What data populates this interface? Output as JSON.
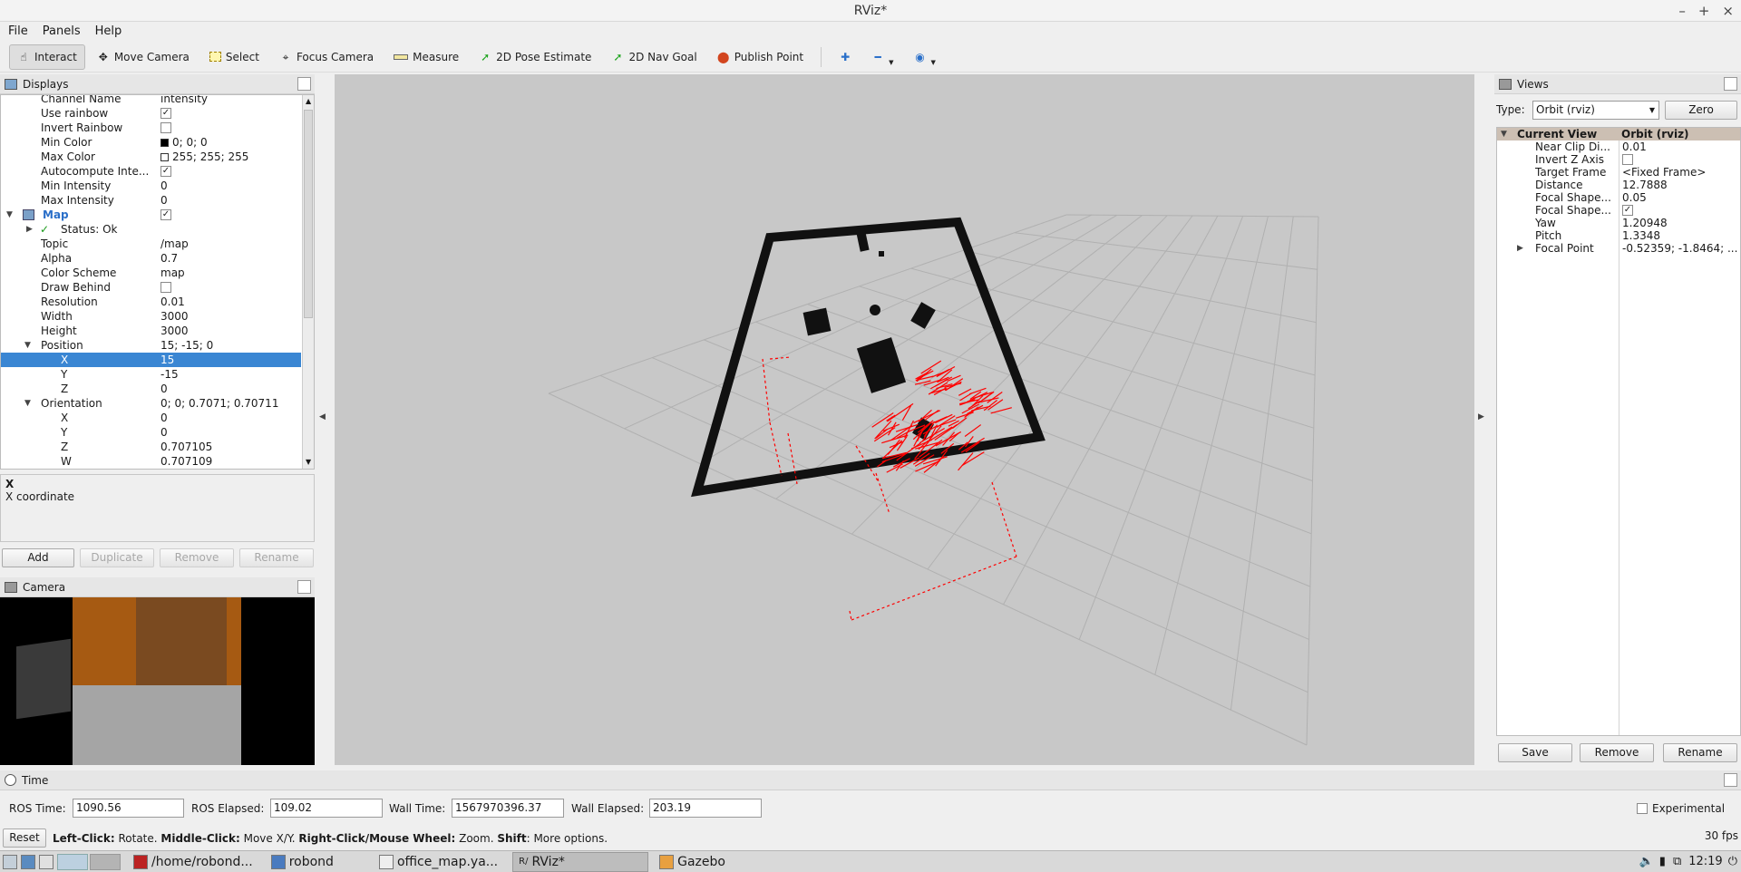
{
  "window": {
    "title": "RViz*",
    "buttons": [
      "–",
      "+",
      "×"
    ]
  },
  "menu": [
    "File",
    "Panels",
    "Help"
  ],
  "toolbar": {
    "tools": [
      "Interact",
      "Move Camera",
      "Select",
      "Focus Camera",
      "Measure",
      "2D Pose Estimate",
      "2D Nav Goal",
      "Publish Point"
    ]
  },
  "displays": {
    "title": "Displays",
    "rows": [
      {
        "key": "Channel Name",
        "value": "intensity"
      },
      {
        "key": "Use rainbow",
        "check": "✓"
      },
      {
        "key": "Invert Rainbow",
        "check": ""
      },
      {
        "key": "Min Color",
        "value": "0; 0; 0"
      },
      {
        "key": "Max Color",
        "value": "255; 255; 255"
      },
      {
        "key": "Autocompute Inte...",
        "check": "✓"
      },
      {
        "key": "Min Intensity",
        "value": "0"
      },
      {
        "key": "Max Intensity",
        "value": "0"
      },
      {
        "key": "Map",
        "check": "✓"
      },
      {
        "key": "Status: Ok"
      },
      {
        "key": "Topic",
        "value": "/map"
      },
      {
        "key": "Alpha",
        "value": "0.7"
      },
      {
        "key": "Color Scheme",
        "value": "map"
      },
      {
        "key": "Draw Behind",
        "check": ""
      },
      {
        "key": "Resolution",
        "value": "0.01"
      },
      {
        "key": "Width",
        "value": "3000"
      },
      {
        "key": "Height",
        "value": "3000"
      },
      {
        "key": "Position",
        "value": "15; -15; 0"
      },
      {
        "key": "X",
        "value": "15"
      },
      {
        "key": "Y",
        "value": "-15"
      },
      {
        "key": "Z",
        "value": "0"
      },
      {
        "key": "Orientation",
        "value": "0; 0; 0.7071; 0.70711"
      },
      {
        "key": "X",
        "value": "0"
      },
      {
        "key": "Y",
        "value": "0"
      },
      {
        "key": "Z",
        "value": "0.707105"
      },
      {
        "key": "W",
        "value": "0.707109"
      }
    ],
    "desc_title": "X",
    "desc_text": "X coordinate",
    "buttons": [
      "Add",
      "Duplicate",
      "Remove",
      "Rename"
    ]
  },
  "camera": {
    "title": "Camera"
  },
  "views": {
    "title": "Views",
    "type_label": "Type:",
    "type_value": "Orbit (rviz)",
    "zero": "Zero",
    "header_key": "Current View",
    "header_value": "Orbit (rviz)",
    "rows": [
      {
        "key": "Near Clip Di...",
        "value": "0.01"
      },
      {
        "key": "Invert Z Axis",
        "check": ""
      },
      {
        "key": "Target Frame",
        "value": "<Fixed Frame>"
      },
      {
        "key": "Distance",
        "value": "12.7888"
      },
      {
        "key": "Focal Shape...",
        "value": "0.05"
      },
      {
        "key": "Focal Shape...",
        "check": "✓"
      },
      {
        "key": "Yaw",
        "value": "1.20948"
      },
      {
        "key": "Pitch",
        "value": "1.3348"
      },
      {
        "key": "Focal Point",
        "value": "-0.52359; -1.8464; ..."
      }
    ],
    "buttons": [
      "Save",
      "Remove",
      "Rename"
    ]
  },
  "time": {
    "title": "Time",
    "ros_time_label": "ROS Time:",
    "ros_time": "1090.56",
    "ros_elapsed_label": "ROS Elapsed:",
    "ros_elapsed": "109.02",
    "wall_time_label": "Wall Time:",
    "wall_time": "1567970396.37",
    "wall_elapsed_label": "Wall Elapsed:",
    "wall_elapsed": "203.19",
    "experimental": "Experimental"
  },
  "status": {
    "reset": "Reset",
    "b1": "Left-Click:",
    "t1": " Rotate. ",
    "b2": "Middle-Click:",
    "t2": " Move X/Y. ",
    "b3": "Right-Click/Mouse Wheel:",
    "t3": " Zoom. ",
    "b4": "Shift",
    "t4": ": More options.",
    "fps": "30 fps"
  },
  "taskbar": {
    "tasks": [
      "/home/robond...",
      "robond",
      "office_map.ya...",
      "RViz*",
      "Gazebo"
    ],
    "clock": "12:19"
  },
  "colors": {
    "selection": "#3a86d3",
    "laser": "#ff0000",
    "viewport": "#c8c8c8"
  }
}
